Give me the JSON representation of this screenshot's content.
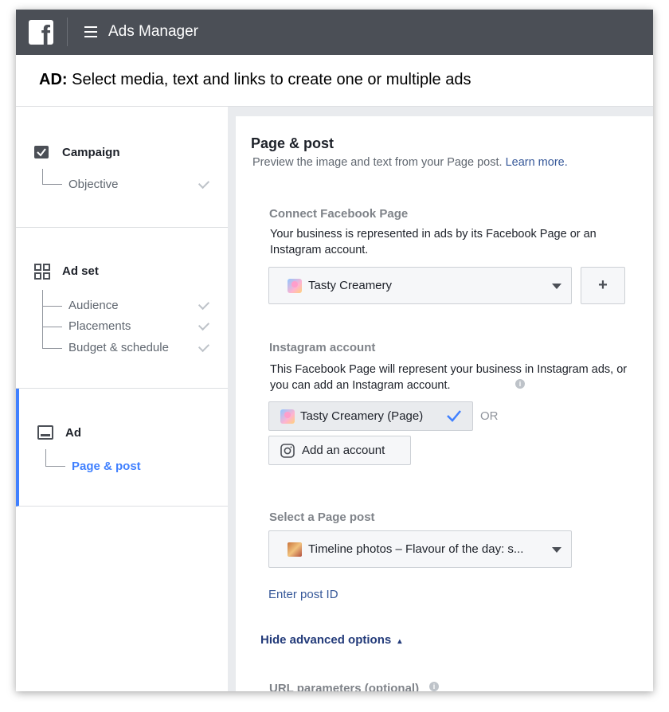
{
  "topbar": {
    "logo_letter": "f",
    "app_title": "Ads Manager"
  },
  "ad_header": {
    "prefix": "AD:",
    "text": " Select media, text and links to create one or multiple ads"
  },
  "sidebar": {
    "campaign": {
      "title": "Campaign",
      "items": [
        "Objective"
      ]
    },
    "adset": {
      "title": "Ad set",
      "items": [
        "Audience",
        "Placements",
        "Budget & schedule"
      ]
    },
    "ad": {
      "title": "Ad",
      "items": [
        "Page & post"
      ]
    }
  },
  "main": {
    "title": "Page & post",
    "description": "Preview the image and text from your Page post. ",
    "learn_more": "Learn more.",
    "connect_page": {
      "label": "Connect Facebook Page",
      "description": "Your business is represented in ads by its Facebook Page or an Instagram account.",
      "selected": "Tasty Creamery",
      "add_button": "+"
    },
    "instagram": {
      "label": "Instagram account",
      "description": "This Facebook Page will represent your business in Instagram ads, or you can add an Instagram account.",
      "page_option": "Tasty Creamery (Page)",
      "or": "OR",
      "add_account": "Add an account"
    },
    "page_post": {
      "label": "Select a Page post",
      "selected": "Timeline photos – Flavour of the day: s...",
      "enter_id": "Enter post ID"
    },
    "advanced": {
      "toggle": "Hide advanced options",
      "arrow": "▴"
    },
    "url_params": {
      "label": "URL parameters (optional)"
    }
  },
  "colors": {
    "topbar": "#4b4f56",
    "accent": "#4080ff",
    "link": "#365899"
  }
}
